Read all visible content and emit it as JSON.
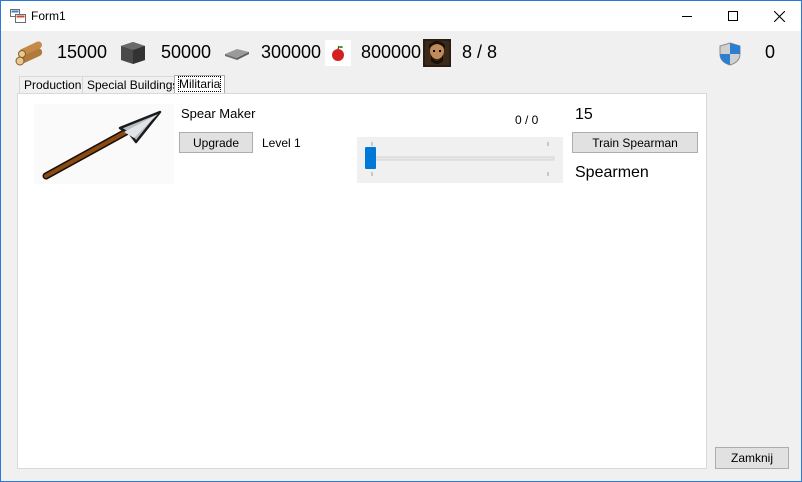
{
  "window": {
    "title": "Form1"
  },
  "resources": {
    "wood": "15000",
    "stone": "50000",
    "iron": "300000",
    "food": "800000",
    "population": "8 / 8",
    "defense": "0"
  },
  "tabs": [
    {
      "label": "Production"
    },
    {
      "label": "Special Buildings"
    },
    {
      "label": "Militaria"
    }
  ],
  "building": {
    "name": "Spear Maker",
    "upgrade_label": "Upgrade",
    "level_text": "Level 1",
    "counter_text": "0 / 0",
    "slider_fraction": 0,
    "unit_count": "15",
    "train_label": "Train Spearman",
    "unit_name": "Spearmen"
  },
  "footer": {
    "close_label": "Zamknij"
  },
  "colors": {
    "accent": "#0078d7",
    "window_border": "#2b79d6"
  }
}
